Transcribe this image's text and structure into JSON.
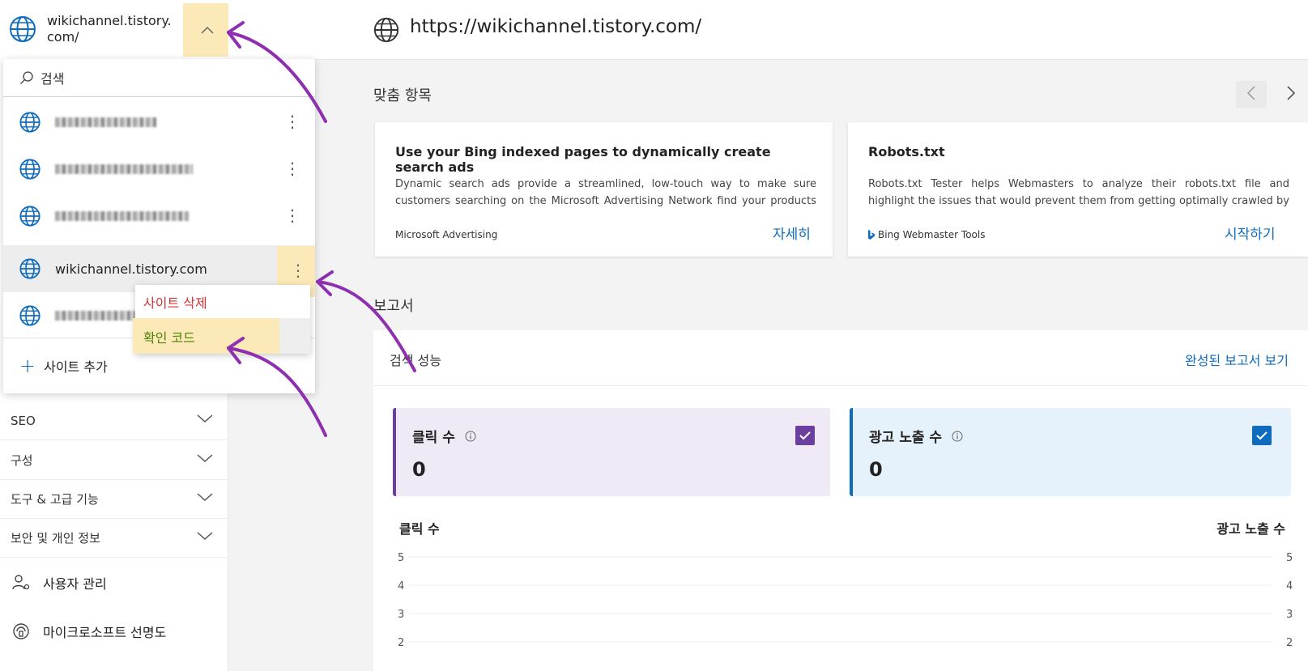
{
  "current_site": "wikichannel.tistory.com/",
  "url": "https://wikichannel.tistory.com/",
  "dropdown": {
    "search_placeholder": "검색",
    "selected_site": "wikichannel.tistory.com",
    "add_site": "사이트 추가",
    "context_menu": {
      "delete": "사이트 삭제",
      "verify": "확인 코드"
    }
  },
  "nav": {
    "seo": "SEO",
    "config": "구성",
    "tools": "도구 & 고급 기능",
    "security": "보안 및 개인 정보",
    "users": "사용자 관리",
    "microsoft": "마이크로소프트 선명도"
  },
  "recommended": {
    "title": "맞춤 항목",
    "cards": [
      {
        "title": "Use your Bing indexed pages to dynamically create search ads",
        "description": "Dynamic search ads provide a streamlined, low-touch way to make sure customers searching on the Microsoft Advertising Network find your products or...",
        "source": "Microsoft Advertising",
        "action": "자세히"
      },
      {
        "title": "Robots.txt",
        "description": "Robots.txt Tester helps Webmasters to analyze their robots.txt file and highlight the issues that would prevent them from getting optimally crawled by Bing and...",
        "source": "Bing Webmaster Tools",
        "action": "시작하기"
      }
    ]
  },
  "report": {
    "title": "보고서",
    "performance_title": "검색 성능",
    "full_report": "완성된 보고서 보기",
    "metrics": [
      {
        "label": "클릭 수",
        "value": "0",
        "color": "#6b3fa0",
        "bg": "#f0eaf6"
      },
      {
        "label": "광고 노출 수",
        "value": "0",
        "color": "#0f6cbd",
        "bg": "#e5f1fb"
      }
    ],
    "chart_left_label": "클릭 수",
    "chart_right_label": "광고 노출 수"
  },
  "chart_data": {
    "type": "line",
    "yticks_left": [
      "5",
      "4",
      "3",
      "2"
    ],
    "yticks_right": [
      "5",
      "4",
      "3",
      "2"
    ],
    "ylim": [
      2,
      5
    ],
    "grid": true,
    "series": []
  }
}
